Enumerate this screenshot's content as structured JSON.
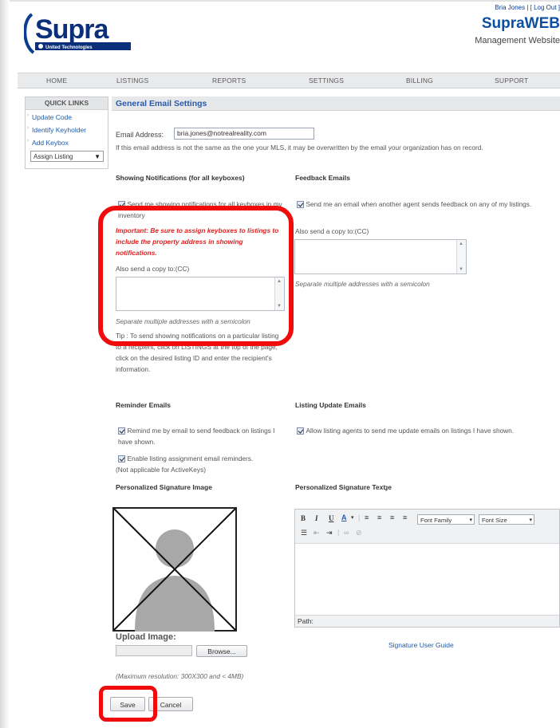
{
  "header": {
    "brand_logo": "Supra",
    "brand_tagline": "United Technologies",
    "user_name": "Bria Jones",
    "separator": "|",
    "logout_label": "[ Log Out ]",
    "app_title": "SupraWEB",
    "app_subtitle": "Management Website"
  },
  "nav": {
    "items": [
      {
        "label": "HOME"
      },
      {
        "label": "LISTINGS"
      },
      {
        "label": "REPORTS"
      },
      {
        "label": "SETTINGS"
      },
      {
        "label": "BILLING"
      },
      {
        "label": "SUPPORT"
      }
    ]
  },
  "quick_links": {
    "title": "QUICK LINKS",
    "links": [
      {
        "label": "Update Code"
      },
      {
        "label": "Identify Keyholder"
      },
      {
        "label": "Add Keybox"
      }
    ],
    "select_value": "Assign Listing"
  },
  "page": {
    "section_title": "General Email Settings",
    "email_label": "Email Address:",
    "email_value": "bria.jones@notrealreality.com",
    "email_note": "If this email address is not the same as the one your MLS, it may be overwritten by the email your organization has on record."
  },
  "showing": {
    "heading": "Showing Notifications (for all keyboxes)",
    "checkbox_label": "Send me showing notifications for all keyboxes in my inventory",
    "important": "Important: Be sure to assign keyboxes to listings to include the property address in showing notifications.",
    "cc_label": "Also send a copy to:(CC)",
    "separator_hint": "Separate multiple addresses with a semicolon",
    "tip": "Tip : To send showing notifications on a particular listing to a recipient, click on LISTINGS at the top of the page, click on the desired listing ID and enter the recipient's information."
  },
  "feedback": {
    "heading": "Feedback Emails",
    "checkbox_label": "Send me an email when another agent sends feedback on any of my listings.",
    "cc_label": "Also send a copy to:(CC)",
    "separator_hint": "Separate multiple addresses with a semicolon"
  },
  "reminder": {
    "heading": "Reminder Emails",
    "checkbox1_label": "Remind me by email to send feedback on listings I have shown.",
    "checkbox2_label": "Enable listing assignment email reminders.",
    "note": "(Not applicable for ActiveKeys)"
  },
  "listing_update": {
    "heading": "Listing Update Emails",
    "checkbox_label": "Allow listing agents to send me update emails on listings I have shown."
  },
  "signature_image": {
    "heading": "Personalized Signature Image",
    "upload_label": "Upload Image:",
    "browse_label": "Browse...",
    "max_note": "(Maximum resolution: 300X300 and < 4MB)"
  },
  "signature_text": {
    "heading": "Personalized Signature Text",
    "font_family": "Font Family",
    "font_size": "Font Size",
    "path_label": "Path:",
    "guide_link": "Signature User Guide",
    "toolbar_bold": "B",
    "toolbar_italic": "I",
    "toolbar_underline": "U",
    "toolbar_color": "A"
  },
  "actions": {
    "save_label": "Save",
    "cancel_label": "Cancel"
  },
  "colors": {
    "accent": "#2a5aa8",
    "highlight": "#f00c0c",
    "warning_text": "#e02020"
  }
}
